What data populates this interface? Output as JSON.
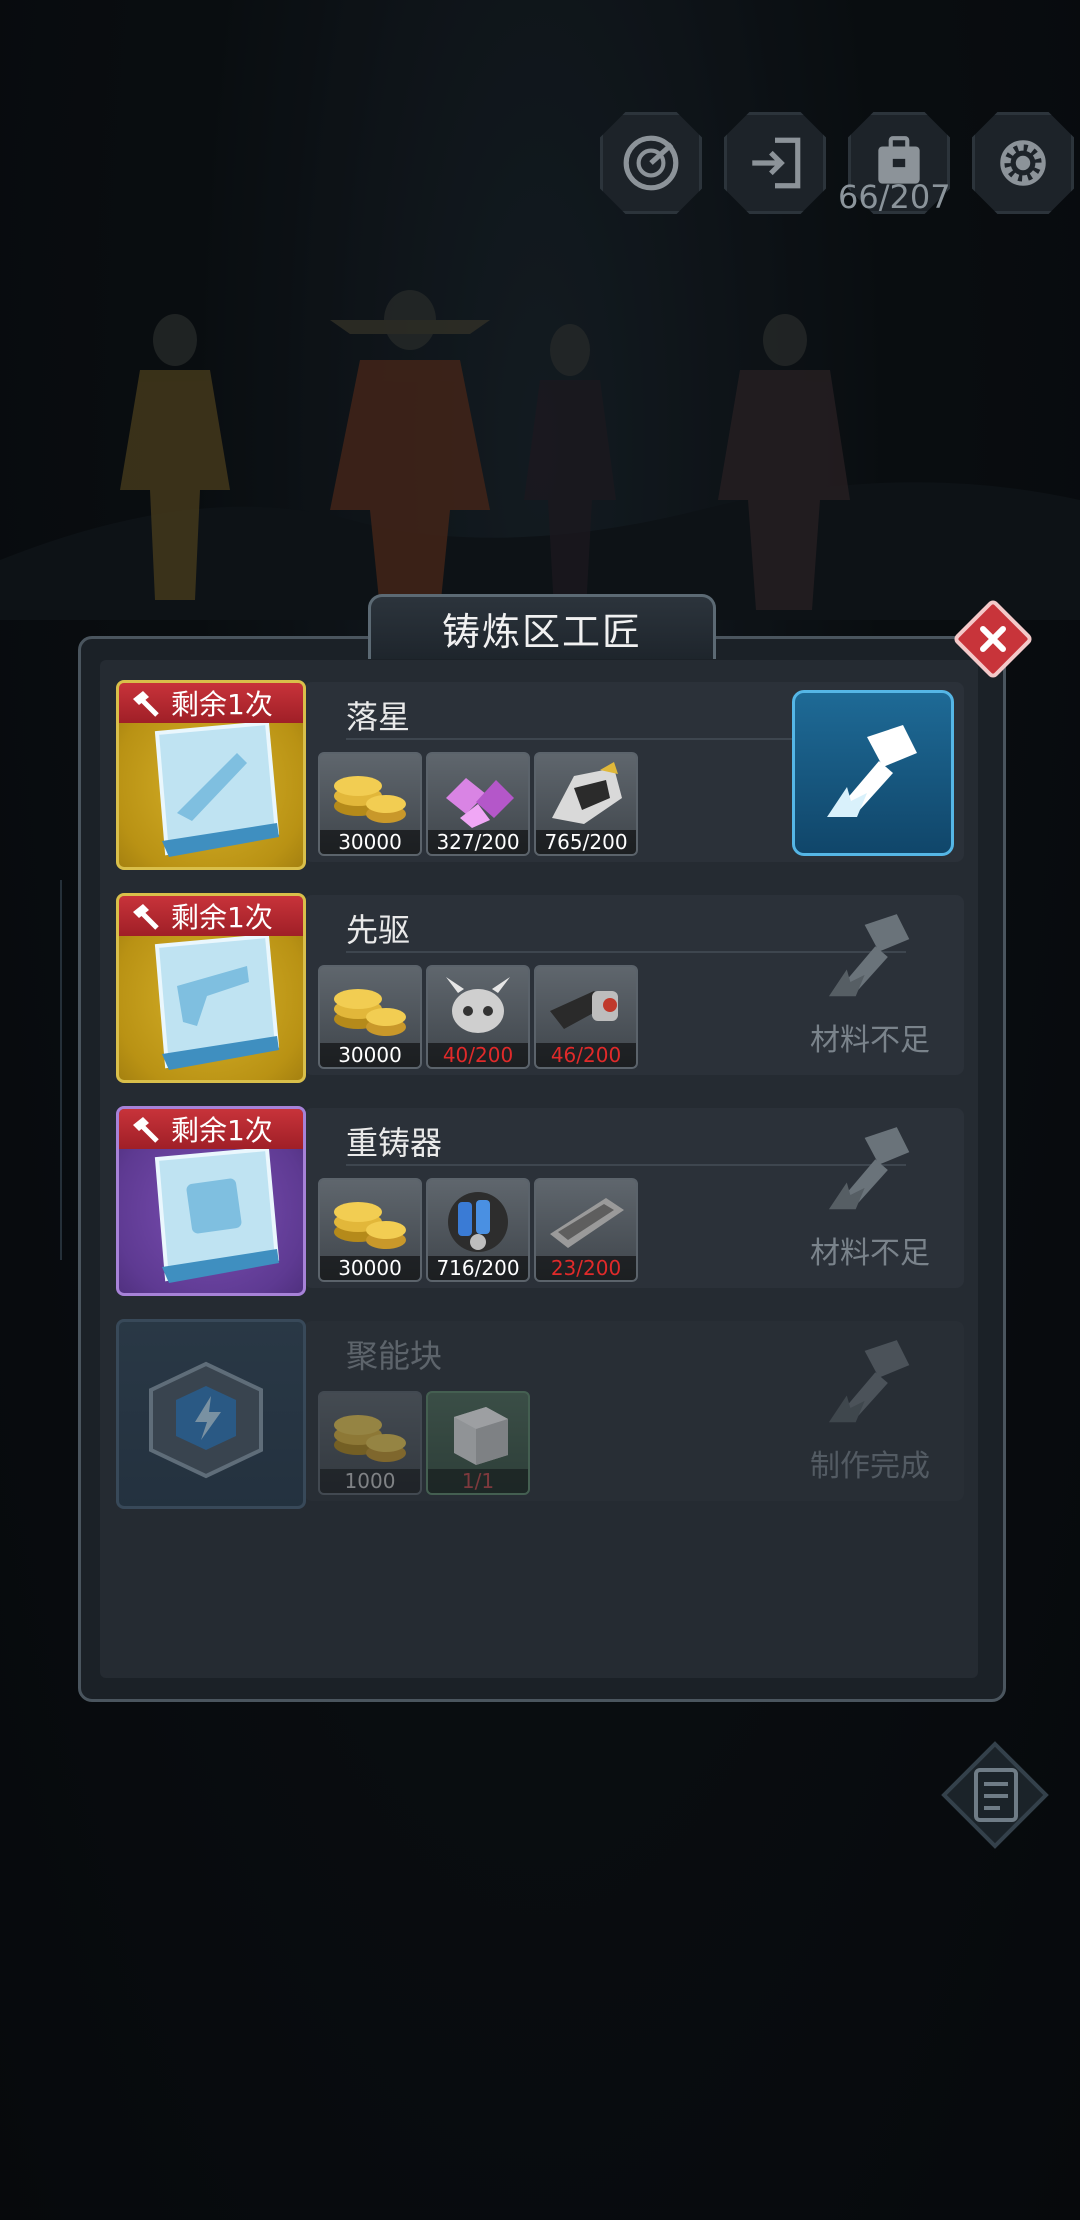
{
  "hud": {
    "buttons": [
      {
        "name": "radar-icon"
      },
      {
        "name": "exit-door-icon"
      },
      {
        "name": "backpack-icon"
      },
      {
        "name": "gear-icon"
      }
    ],
    "bag_count": "66/207"
  },
  "dialog": {
    "title": "铸炼区工匠",
    "rows": [
      {
        "remain": "剩余1次",
        "name": "落星",
        "card_color": "gold",
        "materials": [
          {
            "icon": "gold-coins-icon",
            "count": "30000",
            "insufficient": false
          },
          {
            "icon": "purple-crystals-icon",
            "count": "327/200",
            "insufficient": false
          },
          {
            "icon": "mech-part-icon",
            "count": "765/200",
            "insufficient": false
          }
        ],
        "action": "forge"
      },
      {
        "remain": "剩余1次",
        "name": "先驱",
        "card_color": "gold",
        "materials": [
          {
            "icon": "gold-coins-icon",
            "count": "30000",
            "insufficient": false
          },
          {
            "icon": "beast-skull-icon",
            "count": "40/200",
            "insufficient": true
          },
          {
            "icon": "gun-barrel-icon",
            "count": "46/200",
            "insufficient": true
          }
        ],
        "action": "材料不足"
      },
      {
        "remain": "剩余1次",
        "name": "重铸器",
        "card_color": "purple",
        "materials": [
          {
            "icon": "gold-coins-icon",
            "count": "30000",
            "insufficient": false
          },
          {
            "icon": "battery-drum-icon",
            "count": "716/200",
            "insufficient": false
          },
          {
            "icon": "metal-plate-icon",
            "count": "23/200",
            "insufficient": true
          }
        ],
        "action": "材料不足"
      },
      {
        "remain": "",
        "name": "聚能块",
        "card_color": "locked",
        "materials": [
          {
            "icon": "gold-coins-icon",
            "count": "1000",
            "insufficient": false
          },
          {
            "icon": "white-cube-icon",
            "count": "1/1",
            "insufficient": true
          }
        ],
        "action": "制作完成"
      }
    ]
  }
}
